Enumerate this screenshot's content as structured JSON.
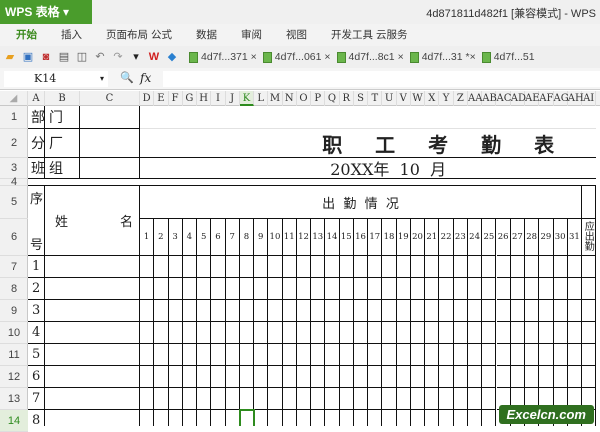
{
  "app": {
    "logo": "WPS 表格",
    "title": "4d871811d482f1 [兼容模式] - WPS"
  },
  "menu": [
    "开始",
    "插入",
    "页面布局",
    "公式",
    "数据",
    "审阅",
    "视图",
    "开发工具",
    "云服务"
  ],
  "tabs": [
    "4d7f...371 ×",
    "4d7f...061 ×",
    "4d7f...8c1 ×",
    "4d7f...31 *×",
    "4d7f...51"
  ],
  "formula": {
    "cell_ref": "K14",
    "fx": "fx",
    "value": ""
  },
  "columns": [
    "A",
    "B",
    "C",
    "D",
    "E",
    "F",
    "G",
    "H",
    "I",
    "J",
    "K",
    "L",
    "M",
    "N",
    "O",
    "P",
    "Q",
    "R",
    "S",
    "T",
    "U",
    "V",
    "W",
    "X",
    "Y",
    "Z",
    "AA",
    "AB",
    "AC",
    "AD",
    "AE",
    "AF",
    "AG",
    "AH",
    "AI"
  ],
  "selected_col": "K",
  "rows": [
    "1",
    "2",
    "3",
    "4",
    "5",
    "6",
    "7",
    "8",
    "9",
    "10",
    "11",
    "12",
    "13",
    "14"
  ],
  "selected_row": "14",
  "sheet": {
    "labels": [
      {
        "a": "部",
        "b": "门"
      },
      {
        "a": "分",
        "b": "厂"
      },
      {
        "a": "班",
        "b": "组"
      }
    ],
    "title": "职 工 考 勤 表",
    "subtitle": "20XX年  10  月",
    "seq_top": "序",
    "seq_bottom": "号",
    "name_a": "姓",
    "name_b": "名",
    "attendance": "出  勤  情  况",
    "days": [
      "1",
      "2",
      "3",
      "4",
      "5",
      "6",
      "7",
      "8",
      "9",
      "10",
      "11",
      "12",
      "13",
      "14",
      "15",
      "16",
      "17",
      "18",
      "19",
      "20",
      "21",
      "22",
      "23",
      "24",
      "25",
      "26",
      "27",
      "28",
      "29",
      "30",
      "31"
    ],
    "should_attend": "应出勤",
    "seq_numbers": [
      "1",
      "2",
      "3",
      "4",
      "5",
      "6",
      "7",
      "8"
    ]
  },
  "watermark": "Excelcn.com"
}
